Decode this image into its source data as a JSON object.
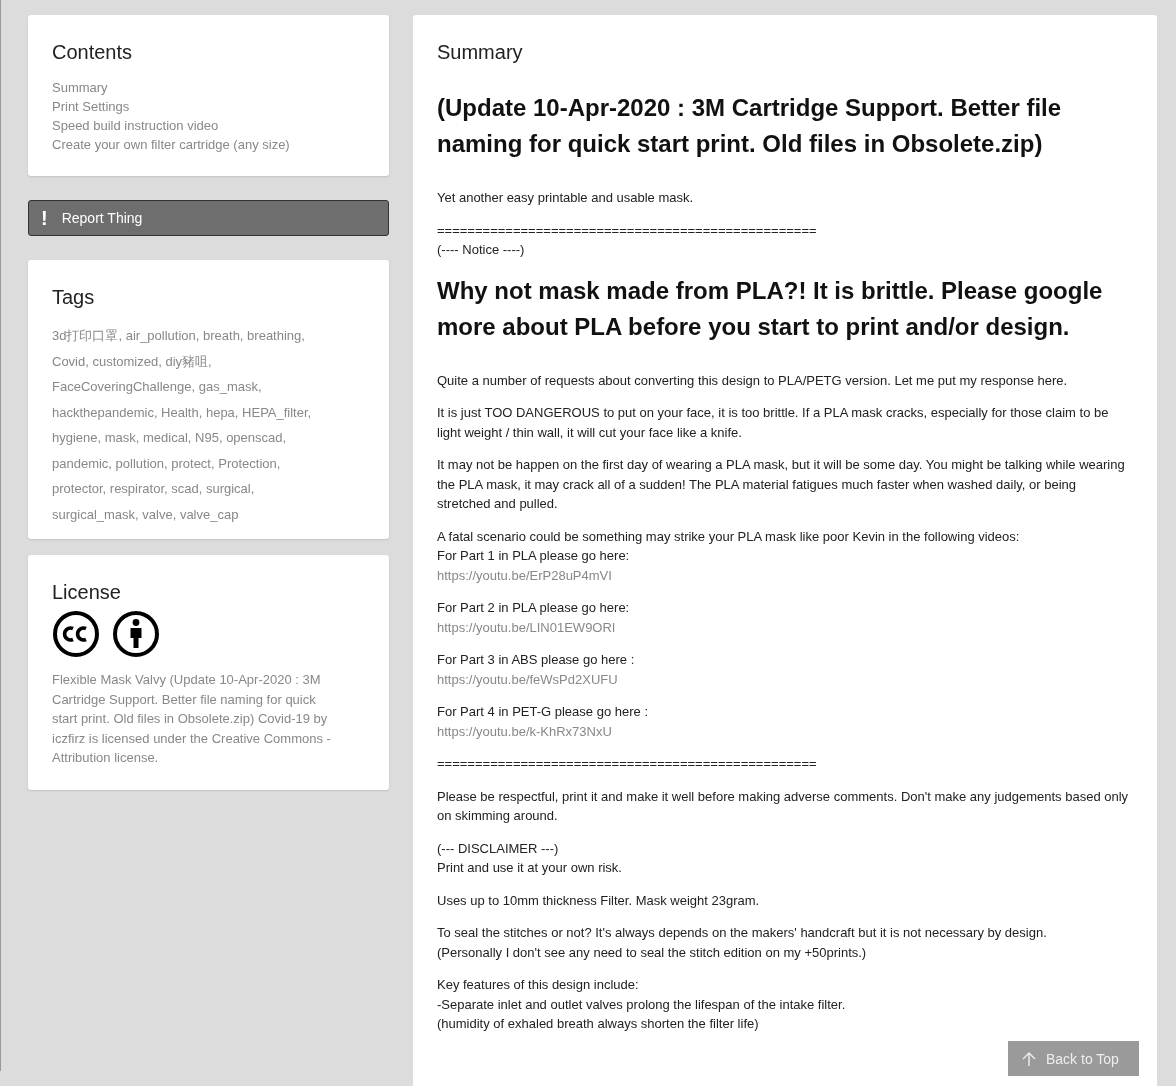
{
  "contents": {
    "title": "Contents",
    "items": [
      "Summary",
      "Print Settings",
      "Speed build instruction video",
      "Create your own filter cartridge (any size)"
    ]
  },
  "report_button": {
    "icon": "!",
    "label": "Report Thing"
  },
  "tags": {
    "title": "Tags",
    "text": "3d打印口罩, air_pollution, breath, breathing, Covid, customized, diy豬咀, FaceCoveringChallenge, gas_mask, hackthepandemic, Health, hepa, HEPA_filter, hygiene, mask, medical, N95, openscad, pandemic, pollution, protect, Protection, protector, respirator, scad, surgical, surgical_mask, valve, valve_cap"
  },
  "license": {
    "title": "License",
    "text": "Flexible Mask Valvy (Update 10-Apr-2020 : 3M Cartridge Support. Better file naming for quick start print. Old files in Obsolete.zip) Covid-19 by  iczfirz  is licensed under the  Creative Commons - Attribution  license."
  },
  "summary": {
    "title": "Summary",
    "blocks": [
      {
        "kind": "heading",
        "text": "(Update 10-Apr-2020 : 3M Cartridge Support. Better file naming for quick start print. Old files in Obsolete.zip)"
      },
      {
        "kind": "para",
        "lines": [
          {
            "kind": "text",
            "text": "Yet another easy printable and usable mask."
          }
        ]
      },
      {
        "kind": "para",
        "lines": [
          {
            "kind": "text",
            "text": "=================================================="
          },
          {
            "kind": "text",
            "text": "(---- Notice ----)"
          }
        ]
      },
      {
        "kind": "heading",
        "text": "Why not mask made from PLA?! It is brittle. Please google more about PLA before you start to print and/or design."
      },
      {
        "kind": "para",
        "lines": [
          {
            "kind": "text",
            "text": "Quite a number of requests about converting this design to PLA/PETG version. Let me put my response here."
          }
        ]
      },
      {
        "kind": "para",
        "lines": [
          {
            "kind": "text",
            "text": "It is just TOO DANGEROUS to put on your face, it is too brittle. If a PLA mask cracks, especially for those claim to be light weight / thin wall, it will cut your face like a knife."
          }
        ]
      },
      {
        "kind": "para",
        "lines": [
          {
            "kind": "text",
            "text": "It may not be happen on the first day of wearing a PLA mask, but it will be some day. You might be talking while wearing the PLA mask, it may crack all of a sudden! The PLA material fatigues much faster when washed daily, or being stretched and pulled."
          }
        ]
      },
      {
        "kind": "para",
        "lines": [
          {
            "kind": "text",
            "text": "A fatal scenario could be something may strike your PLA mask like poor Kevin in the following videos:"
          },
          {
            "kind": "text",
            "text": "For Part 1 in PLA please go here:"
          },
          {
            "kind": "link",
            "text": "https://youtu.be/ErP28uP4mVI"
          }
        ]
      },
      {
        "kind": "para",
        "lines": [
          {
            "kind": "text",
            "text": "For Part 2 in PLA please go here:"
          },
          {
            "kind": "link",
            "text": "https://youtu.be/LIN01EW9ORI"
          }
        ]
      },
      {
        "kind": "para",
        "lines": [
          {
            "kind": "text",
            "text": "For Part 3 in ABS please go here :"
          },
          {
            "kind": "link",
            "text": "https://youtu.be/feWsPd2XUFU"
          }
        ]
      },
      {
        "kind": "para",
        "lines": [
          {
            "kind": "text",
            "text": "For Part 4 in PET-G please go here :"
          },
          {
            "kind": "link",
            "text": "https://youtu.be/k-KhRx73NxU"
          }
        ]
      },
      {
        "kind": "para",
        "lines": [
          {
            "kind": "text",
            "text": "=================================================="
          }
        ]
      },
      {
        "kind": "para",
        "lines": [
          {
            "kind": "text",
            "text": "Please be respectful, print it and make it well before making adverse comments. Don't make any judgements based only on skimming around."
          }
        ]
      },
      {
        "kind": "para",
        "lines": [
          {
            "kind": "text",
            "text": "(--- DISCLAIMER ---)"
          },
          {
            "kind": "text",
            "text": "Print and use it at your own risk."
          }
        ]
      },
      {
        "kind": "para",
        "lines": [
          {
            "kind": "text",
            "text": "Uses up to 10mm thickness Filter. Mask weight 23gram."
          }
        ]
      },
      {
        "kind": "para",
        "lines": [
          {
            "kind": "text",
            "text": "To seal the stitches or not? It's always depends on the makers' handcraft but it is not necessary by design."
          },
          {
            "kind": "text",
            "text": "(Personally I don't see any need to seal the stitch edition on my +50prints.)"
          }
        ]
      },
      {
        "kind": "para",
        "lines": [
          {
            "kind": "text",
            "text": "Key features of this design include:"
          },
          {
            "kind": "text",
            "text": "-Separate inlet and outlet valves prolong the lifespan of the intake filter."
          },
          {
            "kind": "text",
            "text": "(humidity of exhaled breath always shorten the filter life)"
          }
        ]
      }
    ]
  },
  "back_to_top": {
    "label": "Back to Top"
  }
}
